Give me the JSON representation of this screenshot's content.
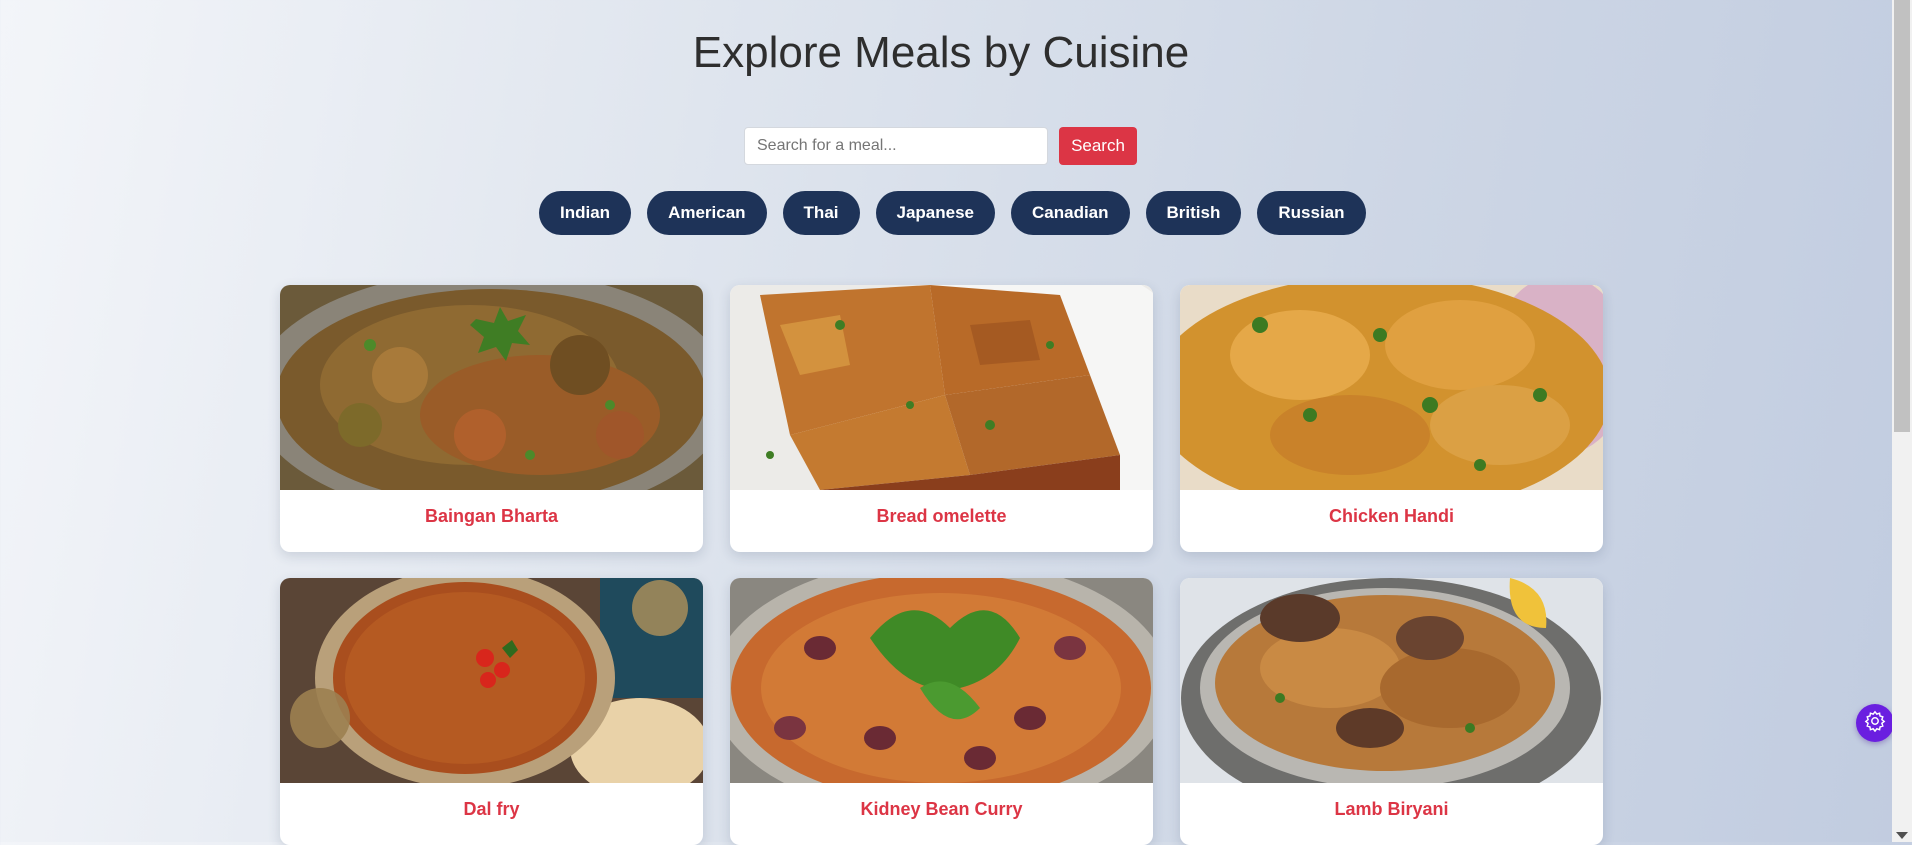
{
  "title": "Explore Meals by Cuisine",
  "search": {
    "placeholder": "Search for a meal...",
    "value": "",
    "button_label": "Search"
  },
  "cuisines": [
    "Indian",
    "American",
    "Thai",
    "Japanese",
    "Canadian",
    "British",
    "Russian"
  ],
  "meals": [
    {
      "name": "Baingan Bharta"
    },
    {
      "name": "Bread omelette"
    },
    {
      "name": "Chicken Handi"
    },
    {
      "name": "Dal fry"
    },
    {
      "name": "Kidney Bean Curry"
    },
    {
      "name": "Lamb Biryani"
    }
  ],
  "colors": {
    "accent": "#dc3545",
    "pill": "#1e3358",
    "widget": "#6a1fe0"
  },
  "icons": {
    "widget": "gear-icon",
    "scroll_down": "chevron-down-icon"
  }
}
